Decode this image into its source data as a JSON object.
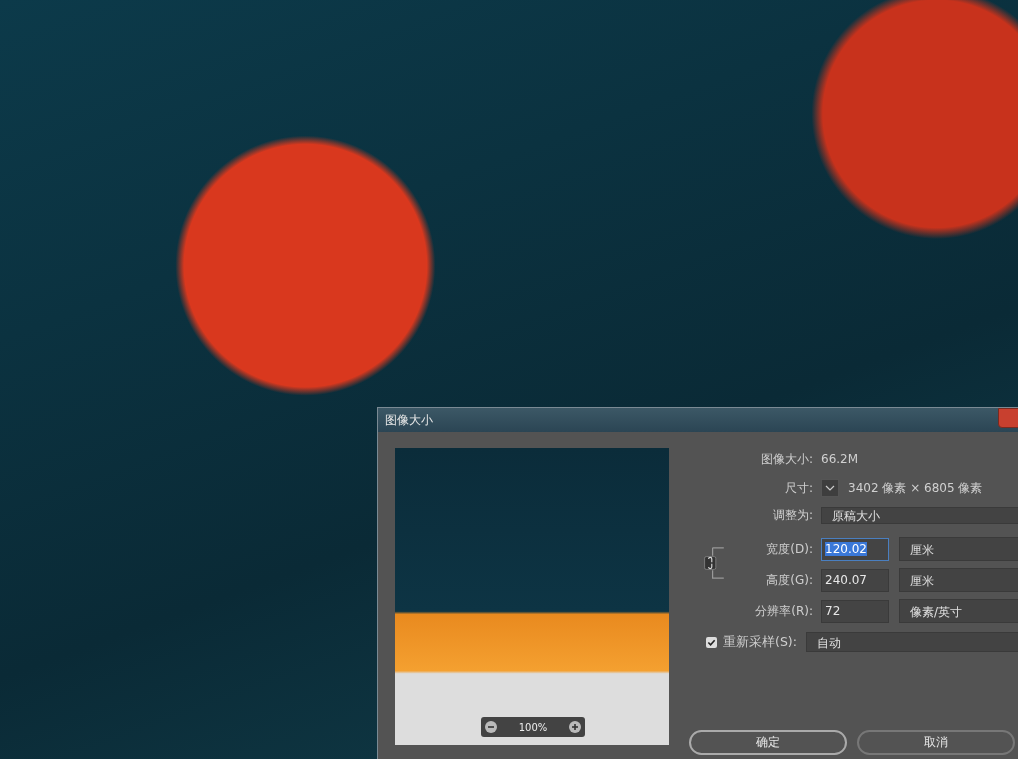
{
  "dialog": {
    "title": "图像大小",
    "preview": {
      "zoom": "100%"
    },
    "image_size": {
      "label": "图像大小:",
      "value": "66.2M"
    },
    "dimensions": {
      "label": "尺寸:",
      "value": "3402 像素  ×  6805 像素"
    },
    "fit_to": {
      "label": "调整为:",
      "value": "原稿大小"
    },
    "fields": [
      {
        "label": "宽度(D):",
        "value": "120.02",
        "unit": "厘米",
        "focused": true
      },
      {
        "label": "高度(G):",
        "value": "240.07",
        "unit": "厘米",
        "focused": false
      },
      {
        "label": "分辨率(R):",
        "value": "72",
        "unit": "像素/英寸",
        "focused": false
      }
    ],
    "resample": {
      "label": "重新采样(S):",
      "checked": true,
      "value": "自动"
    },
    "buttons": [
      "确定",
      "取消"
    ]
  }
}
